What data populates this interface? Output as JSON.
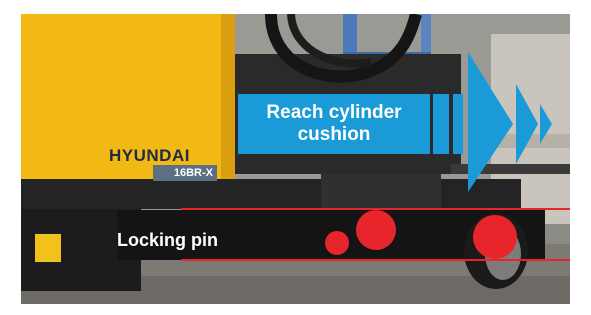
{
  "callouts": {
    "reach_label": "Reach cylinder cushion",
    "pin_label": "Locking pin"
  },
  "truck": {
    "brand": "HYUNDAI",
    "model": "16BR-X"
  },
  "colors": {
    "callout_blue": "#1a9ad6",
    "marker_red": "#e8252b",
    "truck_yellow": "#f2b814",
    "chassis_black": "#1b1b1b"
  }
}
